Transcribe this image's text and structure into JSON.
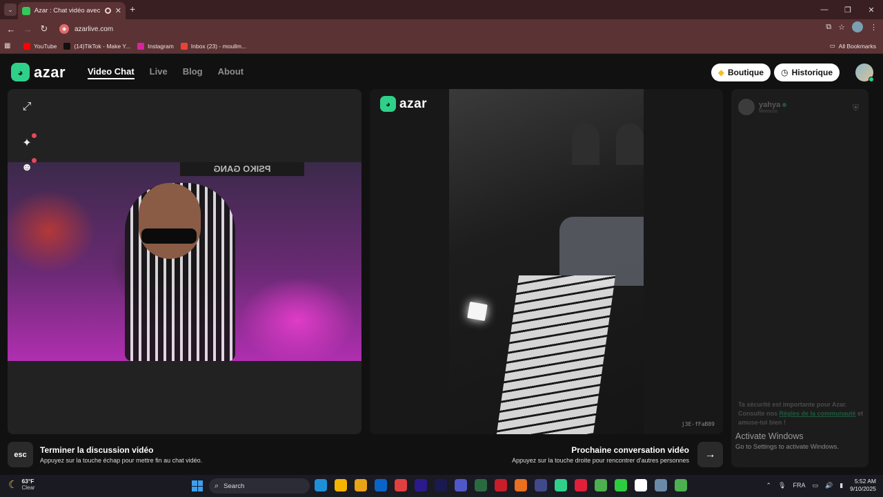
{
  "browser": {
    "tab_title": "Azar : Chat vidéo avec de n",
    "new_tab": "+",
    "url": "azarlive.com",
    "bookmarks": [
      {
        "label": "YouTube",
        "color": "#ff0000"
      },
      {
        "label": "(14)TikTok - Make Y...",
        "color": "#111111"
      },
      {
        "label": "Instagram",
        "color": "#d6249f"
      },
      {
        "label": "Inbox (23) - moullm...",
        "color": "#ea4335"
      }
    ],
    "all_bookmarks": "All Bookmarks"
  },
  "nav": {
    "logo": "azar",
    "links": [
      "Video Chat",
      "Live",
      "Blog",
      "About"
    ],
    "boutique": "Boutique",
    "historique": "Historique"
  },
  "left_cam": {
    "banner": "PSIKO GANG"
  },
  "mid": {
    "logo": "azar",
    "code": "j3E-fFaB89"
  },
  "chat": {
    "username": "yahya",
    "country": "Morocco",
    "safety_pre": "Ta sécurité est importante pour Azar. Consulte nos ",
    "safety_link": "Règles de la communauté",
    "safety_post": " et amuse-toi bien !"
  },
  "windows": {
    "activate_title": "Activate Windows",
    "activate_sub": "Go to Settings to activate Windows."
  },
  "actions": {
    "esc_key": "esc",
    "end_title": "Terminer la discussion vidéo",
    "end_sub": "Appuyez sur la touche échap pour mettre fin au chat vidéo.",
    "next_title": "Prochaine conversation vidéo",
    "next_sub": "Appuyez sur la touche droite pour rencontrer d'autres personnes"
  },
  "taskbar": {
    "temp": "63°F",
    "weather": "Clear",
    "search": "Search",
    "lang": "FRA",
    "time": "5:52 AM",
    "date": "9/10/2025",
    "app_colors": [
      "#1e90d8",
      "#f4b400",
      "#e8a317",
      "#0a64c8",
      "#e04040",
      "#2a1a8c",
      "#1a1a50",
      "#5058c8",
      "#2a6a40",
      "#c81e2a",
      "#e87020",
      "#404a8a",
      "#2fd08a",
      "#e0203a",
      "#4caf50",
      "#2ecc40",
      "#ffffff",
      "#6a8aa8",
      "#4caf50"
    ]
  }
}
